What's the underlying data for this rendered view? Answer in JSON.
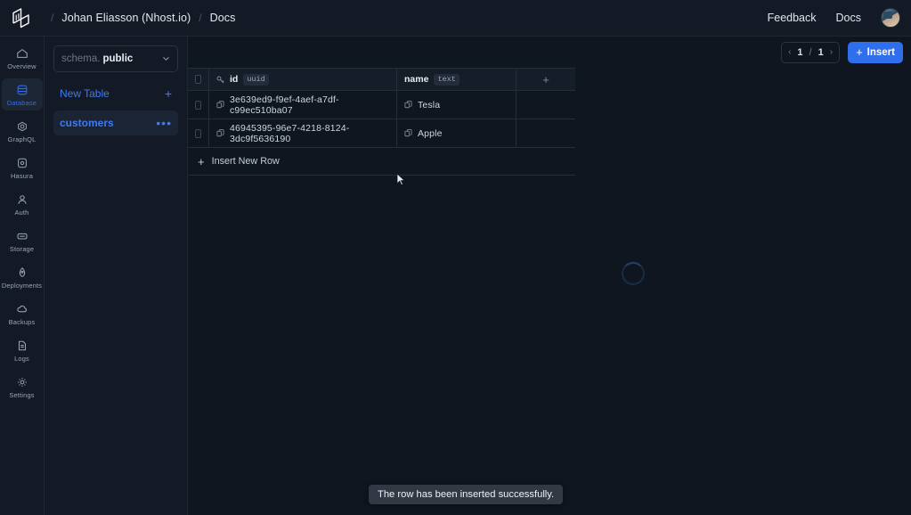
{
  "topbar": {
    "logo_icon": "nhost-logo-icon",
    "breadcrumb": {
      "separator": "/",
      "org": "Johan Eliasson (Nhost.io)",
      "project": "Docs"
    },
    "feedback_label": "Feedback",
    "docs_label": "Docs",
    "avatar_name": "user-avatar"
  },
  "rail": {
    "items": [
      {
        "label": "Overview",
        "icon": "home-icon",
        "active": false
      },
      {
        "label": "Database",
        "icon": "database-icon",
        "active": true
      },
      {
        "label": "GraphQL",
        "icon": "graphql-icon",
        "active": false
      },
      {
        "label": "Hasura",
        "icon": "hasura-icon",
        "active": false
      },
      {
        "label": "Auth",
        "icon": "user-icon",
        "active": false
      },
      {
        "label": "Storage",
        "icon": "storage-icon",
        "active": false
      },
      {
        "label": "Deployments",
        "icon": "rocket-icon",
        "active": false
      },
      {
        "label": "Backups",
        "icon": "cloud-icon",
        "active": false
      },
      {
        "label": "Logs",
        "icon": "document-icon",
        "active": false
      },
      {
        "label": "Settings",
        "icon": "gear-icon",
        "active": false
      }
    ],
    "active_color": "#2f6fed"
  },
  "panel": {
    "schema_prefix": "schema.",
    "schema_value": "public",
    "chevron_icon": "chevron-down-icon",
    "new_table_label": "New Table",
    "new_table_plus": "+",
    "tables": [
      {
        "name": "customers",
        "menu": "•••",
        "selected": true
      }
    ]
  },
  "toolbar": {
    "prev_icon": "‹",
    "next_icon": "›",
    "page_current": "1",
    "page_separator": "/",
    "page_total": "1",
    "insert_label": "Insert",
    "insert_plus": "+",
    "accent_color": "#2f6fed"
  },
  "grid": {
    "columns": [
      {
        "name": "id",
        "type": "uuid",
        "icon": "key-icon"
      },
      {
        "name": "name",
        "type": "text",
        "icon": ""
      }
    ],
    "add_column_icon": "+",
    "rows": [
      {
        "id": "3e639ed9-f9ef-4aef-a7df-c99ec510ba07",
        "name": "Tesla",
        "copy_icon": "copy-icon"
      },
      {
        "id": "46945395-96e7-4218-8124-3dc9f5636190",
        "name": "Apple",
        "copy_icon": "copy-icon"
      }
    ],
    "insert_new_row_label": "Insert New Row",
    "insert_new_row_plus": "+"
  },
  "spinner": {
    "name": "loading-spinner"
  },
  "toast": {
    "message": "The row has been inserted successfully."
  }
}
